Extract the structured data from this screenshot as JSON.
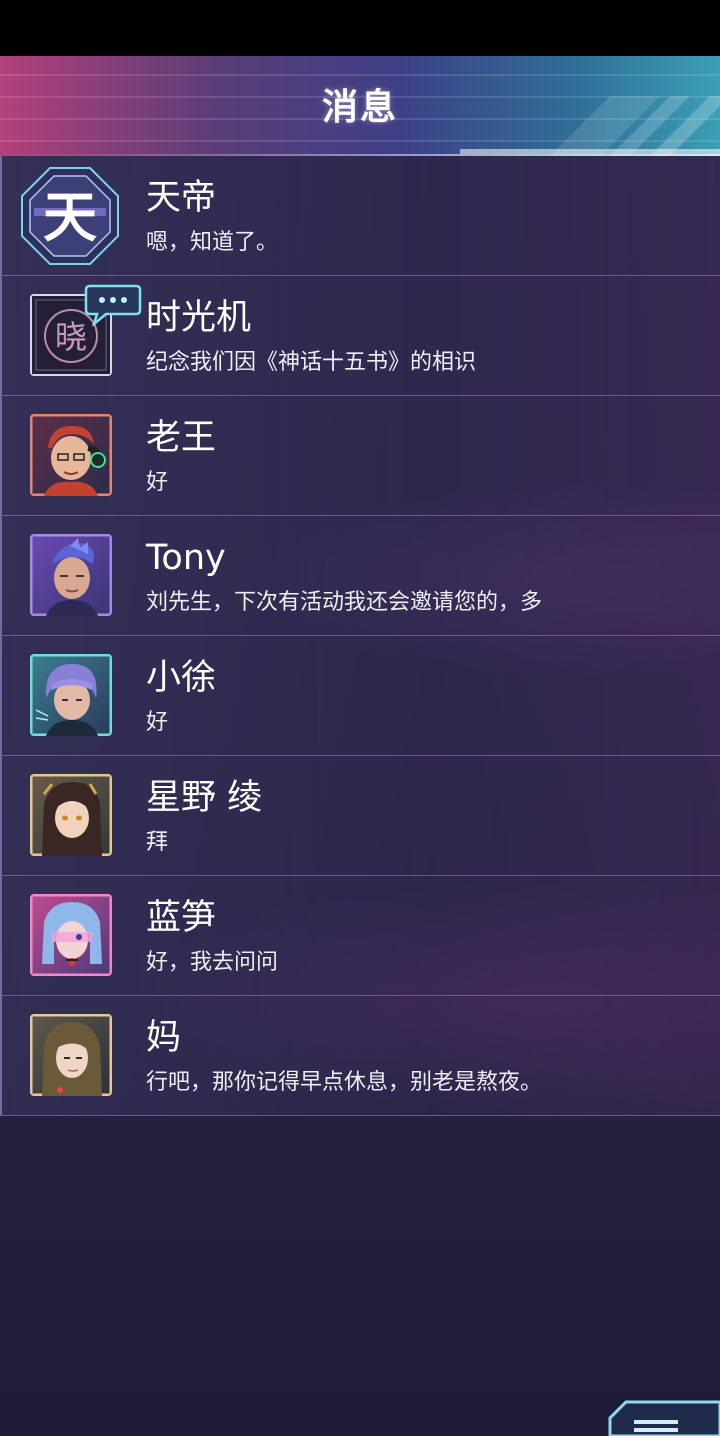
{
  "header": {
    "title": "消息"
  },
  "contacts": [
    {
      "name": "天帝",
      "message": "嗯，知道了。",
      "avatar_icon": "tiandi-hex-logo-icon",
      "avatar_glyph": "天"
    },
    {
      "name": "时光机",
      "message": "纪念我们因《神话十五书》的相识",
      "avatar_icon": "time-machine-stamp-icon",
      "avatar_glyph": "晓"
    },
    {
      "name": "老王",
      "message": "好",
      "avatar_icon": "laowang-avatar-icon"
    },
    {
      "name": "Tony",
      "message": "刘先生，下次有活动我还会邀请您的，多",
      "avatar_icon": "tony-avatar-icon"
    },
    {
      "name": "小徐",
      "message": "好",
      "avatar_icon": "xiaoxu-avatar-icon"
    },
    {
      "name": "星野 绫",
      "message": "拜",
      "avatar_icon": "hoshino-aya-avatar-icon"
    },
    {
      "name": "蓝笋",
      "message": "好，我去问问",
      "avatar_icon": "lansun-avatar-icon"
    },
    {
      "name": "妈",
      "message": "行吧，那你记得早点休息，别老是熬夜。",
      "avatar_icon": "mom-avatar-icon"
    }
  ],
  "colors": {
    "header_left": "#b3407a",
    "header_right": "#3b9fb6",
    "background": "#262240",
    "row_divider": "#c88cdc"
  }
}
